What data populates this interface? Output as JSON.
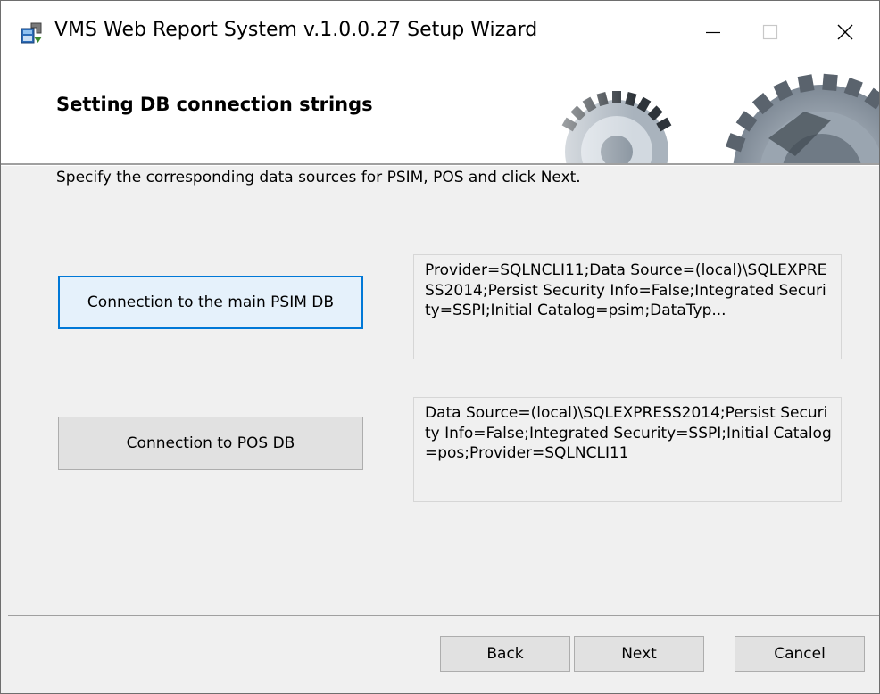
{
  "window": {
    "title": "VMS Web Report System v.1.0.0.27 Setup Wizard",
    "icon": "installer-icon"
  },
  "banner": {
    "title": "Setting DB connection strings",
    "art": "gears-graphic"
  },
  "instruction": "Specify the corresponding data sources for PSIM, POS and click Next.",
  "connections": {
    "psim": {
      "button_label": "Connection to the main PSIM DB",
      "connection_string": "Provider=SQLNCLI11;Data Source=(local)\\SQLEXPRESS2014;Persist Security Info=False;Integrated Security=SSPI;Initial Catalog=psim;DataTyp..."
    },
    "pos": {
      "button_label": "Connection to POS DB",
      "connection_string": "Data Source=(local)\\SQLEXPRESS2014;Persist Security Info=False;Integrated Security=SSPI;Initial Catalog=pos;Provider=SQLNCLI11"
    }
  },
  "footer": {
    "back_label": "Back",
    "next_label": "Next",
    "cancel_label": "Cancel"
  },
  "colors": {
    "focus_border": "#0078d7",
    "button_face": "#e1e1e1",
    "dialog_bg": "#f0f0f0"
  }
}
